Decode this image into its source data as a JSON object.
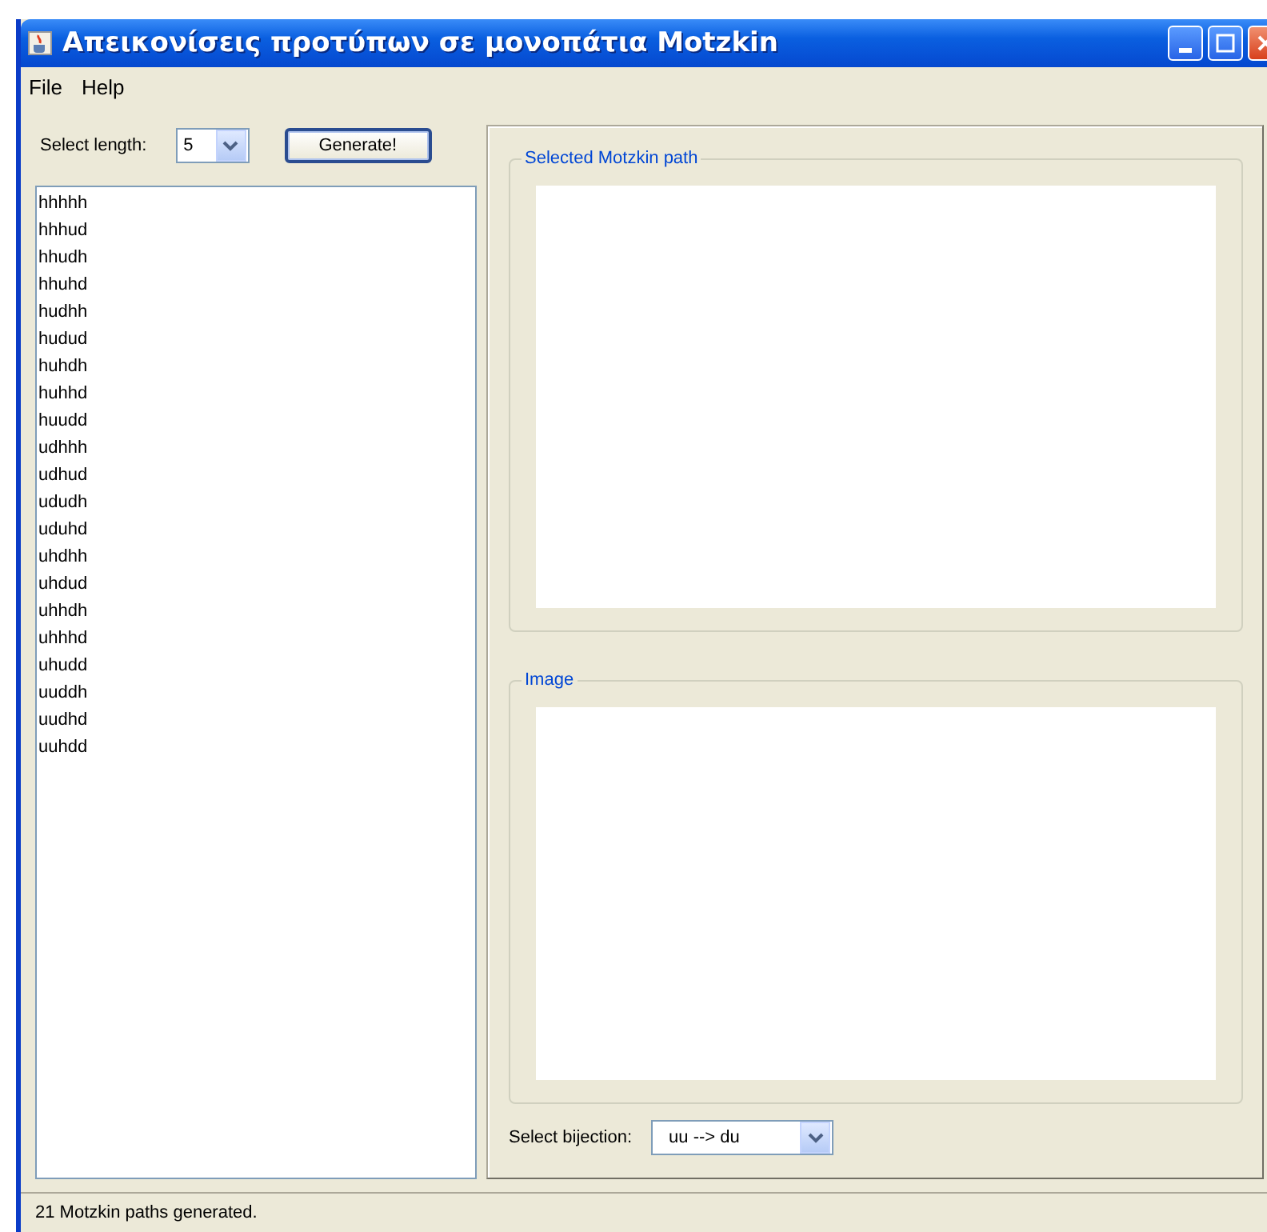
{
  "window": {
    "title": "Απεικονίσεις προτύπων σε μονοπάτια Motzkin"
  },
  "menu": [
    "File",
    "Help"
  ],
  "length_select": {
    "label": "Select length:",
    "value": "5"
  },
  "generate_button": "Generate!",
  "paths": [
    "hhhhh",
    "hhhud",
    "hhudh",
    "hhuhd",
    "hudhh",
    "hudud",
    "huhdh",
    "huhhd",
    "huudd",
    "udhhh",
    "udhud",
    "ududh",
    "uduhd",
    "uhdhh",
    "uhdud",
    "uhhdh",
    "uhhhd",
    "uhudd",
    "uuddh",
    "uudhd",
    "uuhdd"
  ],
  "groups": [
    {
      "title": "Selected Motzkin path"
    },
    {
      "title": "Image"
    }
  ],
  "bijection_select": {
    "label": "Select bijection:",
    "value": "uu --> du"
  },
  "status_bar": "21 Motzkin paths generated."
}
